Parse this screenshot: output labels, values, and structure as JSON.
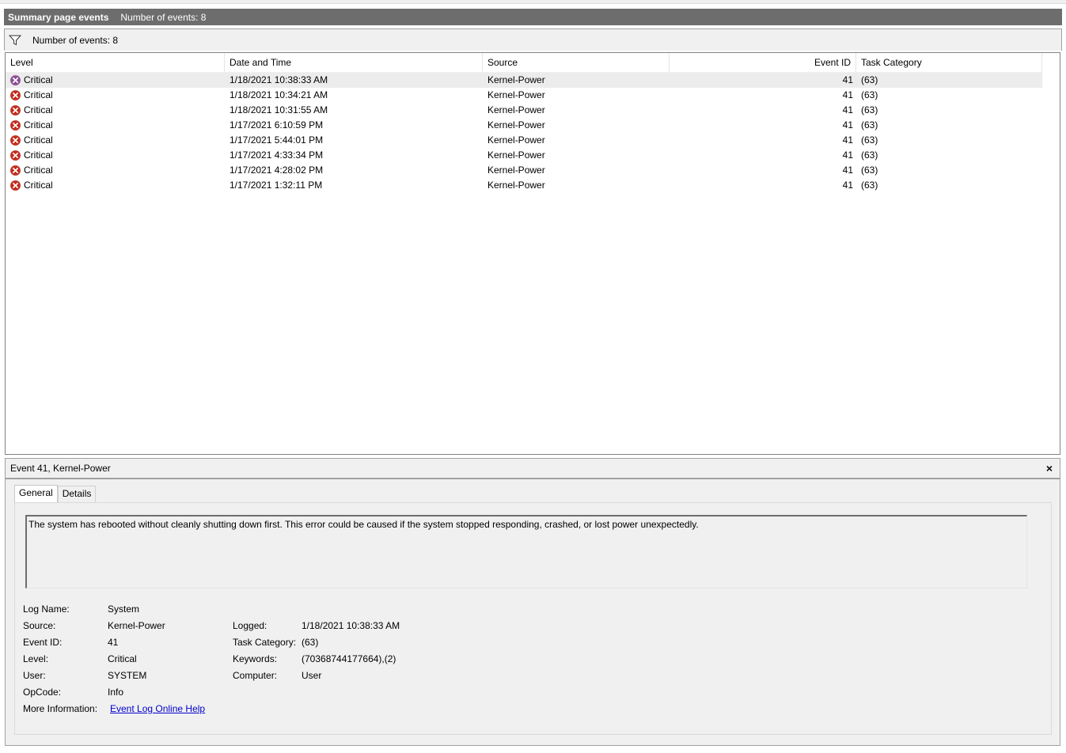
{
  "title_bar": {
    "main": "Summary page events",
    "count": "Number of events: 8"
  },
  "filter_bar": {
    "icon": "filter-icon",
    "label": "Number of events: 8"
  },
  "columns": [
    "Level",
    "Date and Time",
    "Source",
    "Event ID",
    "Task Category"
  ],
  "events": [
    {
      "level": "Critical",
      "datetime": "1/18/2021 10:38:33 AM",
      "source": "Kernel-Power",
      "event_id": "41",
      "task": "(63)"
    },
    {
      "level": "Critical",
      "datetime": "1/18/2021 10:34:21 AM",
      "source": "Kernel-Power",
      "event_id": "41",
      "task": "(63)"
    },
    {
      "level": "Critical",
      "datetime": "1/18/2021 10:31:55 AM",
      "source": "Kernel-Power",
      "event_id": "41",
      "task": "(63)"
    },
    {
      "level": "Critical",
      "datetime": "1/17/2021 6:10:59 PM",
      "source": "Kernel-Power",
      "event_id": "41",
      "task": "(63)"
    },
    {
      "level": "Critical",
      "datetime": "1/17/2021 5:44:01 PM",
      "source": "Kernel-Power",
      "event_id": "41",
      "task": "(63)"
    },
    {
      "level": "Critical",
      "datetime": "1/17/2021 4:33:34 PM",
      "source": "Kernel-Power",
      "event_id": "41",
      "task": "(63)"
    },
    {
      "level": "Critical",
      "datetime": "1/17/2021 4:28:02 PM",
      "source": "Kernel-Power",
      "event_id": "41",
      "task": "(63)"
    },
    {
      "level": "Critical",
      "datetime": "1/17/2021 1:32:11 PM",
      "source": "Kernel-Power",
      "event_id": "41",
      "task": "(63)"
    }
  ],
  "colors": {
    "title_bar": "#6d6d6d",
    "critical_icon": "#c42b1c",
    "selected_row": "#ececec",
    "link": "#0000cc"
  },
  "detail": {
    "header": "Event 41, Kernel-Power",
    "close": "×",
    "tabs": [
      "General",
      "Details"
    ],
    "description": "The system has rebooted without cleanly shutting down first. This error could be caused if the system stopped responding, crashed, or lost power unexpectedly.",
    "labels": {
      "log_name": "Log Name:",
      "source": "Source:",
      "event_id": "Event ID:",
      "level": "Level:",
      "user": "User:",
      "opcode": "OpCode:",
      "more_info": "More Information:",
      "logged": "Logged:",
      "task_category": "Task Category:",
      "keywords": "Keywords:",
      "computer": "Computer:"
    },
    "values": {
      "log_name": "System",
      "source": "Kernel-Power",
      "event_id": "41",
      "level": "Critical",
      "user": "SYSTEM",
      "opcode": "Info",
      "more_info": "Event Log Online Help",
      "logged": "1/18/2021 10:38:33 AM",
      "task_category": "(63)",
      "keywords": "(70368744177664),(2)",
      "computer": "User"
    }
  }
}
